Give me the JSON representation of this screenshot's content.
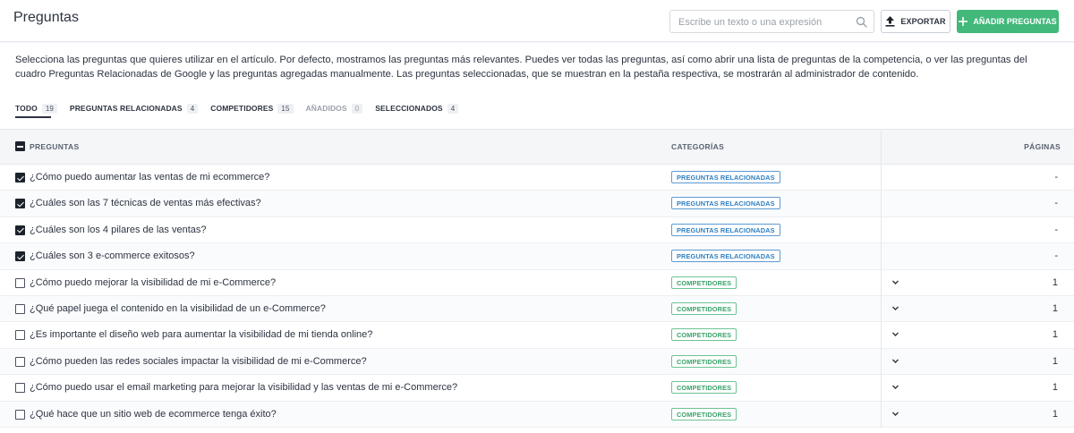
{
  "header": {
    "title": "Preguntas",
    "search_placeholder": "Escribe un texto o una expresión",
    "export_label": "EXPORTAR",
    "add_label": "AÑADIR PREGUNTAS"
  },
  "description": "Selecciona las preguntas que quieres utilizar en el artículo. Por defecto, mostramos las preguntas más relevantes. Puedes ver todas las preguntas, así como abrir una lista de preguntas de la competencia, o ver las preguntas del cuadro Preguntas Relacionadas de Google y las preguntas agregadas manualmente. Las preguntas seleccionadas, que se muestran en la pestaña respectiva, se mostrarán al administrador de contenido.",
  "tabs": [
    {
      "label": "TODO",
      "count": "19"
    },
    {
      "label": "PREGUNTAS RELACIONADAS",
      "count": "4"
    },
    {
      "label": "COMPETIDORES",
      "count": "15"
    },
    {
      "label": "AÑADIDOS",
      "count": "0"
    },
    {
      "label": "SELECCIONADOS",
      "count": "4"
    }
  ],
  "table": {
    "columns": {
      "questions": "PREGUNTAS",
      "categories": "CATEGORÍAS",
      "pages": "PÁGINAS"
    },
    "rows": [
      {
        "question": "¿Cómo puedo aumentar las ventas de mi ecommerce?",
        "category": "PREGUNTAS RELACIONADAS",
        "pages": "-"
      },
      {
        "question": "¿Cuáles son las 7 técnicas de ventas más efectivas?",
        "category": "PREGUNTAS RELACIONADAS",
        "pages": "-"
      },
      {
        "question": "¿Cuáles son los 4 pilares de las ventas?",
        "category": "PREGUNTAS RELACIONADAS",
        "pages": "-"
      },
      {
        "question": "¿Cuáles son 3 e-commerce exitosos?",
        "category": "PREGUNTAS RELACIONADAS",
        "pages": "-"
      },
      {
        "question": "¿Cómo puedo mejorar la visibilidad de mi e-Commerce?",
        "category": "COMPETIDORES",
        "pages": "1"
      },
      {
        "question": "¿Qué papel juega el contenido en la visibilidad de un e-Commerce?",
        "category": "COMPETIDORES",
        "pages": "1"
      },
      {
        "question": "¿Es importante el diseño web para aumentar la visibilidad de mi tienda online?",
        "category": "COMPETIDORES",
        "pages": "1"
      },
      {
        "question": "¿Cómo pueden las redes sociales impactar la visibilidad de mi e-Commerce?",
        "category": "COMPETIDORES",
        "pages": "1"
      },
      {
        "question": "¿Cómo puedo usar el email marketing para mejorar la visibilidad y las ventas de mi e-Commerce?",
        "category": "COMPETIDORES",
        "pages": "1"
      },
      {
        "question": "¿Qué hace que un sitio web de ecommerce tenga éxito?",
        "category": "COMPETIDORES",
        "pages": "1"
      }
    ]
  },
  "colors": {
    "accent_green": "#42b87a",
    "badge_blue": "#2f7fc1",
    "badge_green": "#3aa36b",
    "checkbox_dark": "#1d232c"
  },
  "icons": {
    "search": "search-icon",
    "export": "upload-icon",
    "add": "plus-icon",
    "expand": "chevron-down-icon"
  }
}
